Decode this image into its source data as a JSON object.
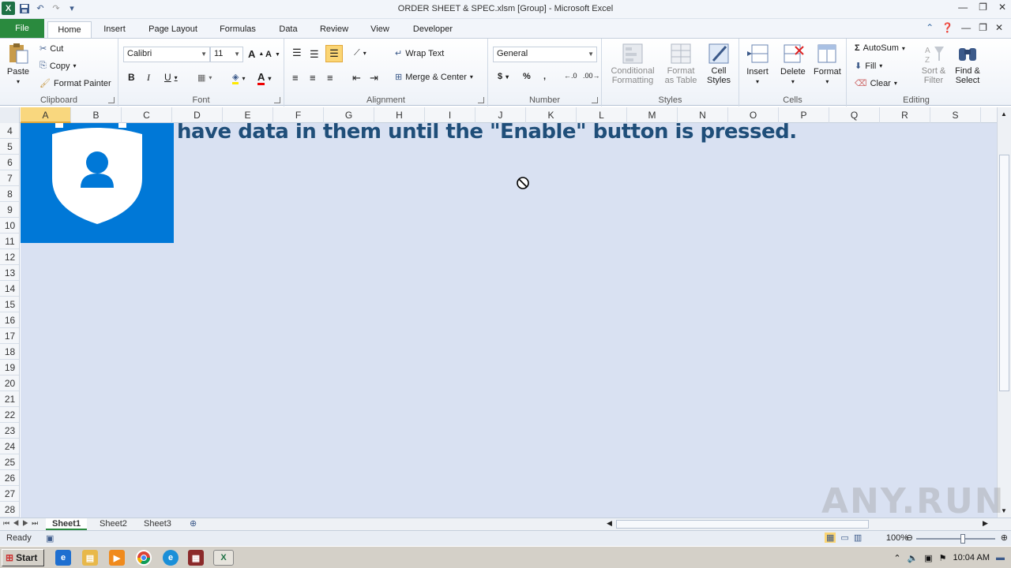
{
  "window": {
    "title": "ORDER SHEET & SPEC.xlsm  [Group]  -  Microsoft Excel"
  },
  "tabs": [
    "File",
    "Home",
    "Insert",
    "Page Layout",
    "Formulas",
    "Data",
    "Review",
    "View",
    "Developer"
  ],
  "ribbon": {
    "clipboard": {
      "paste": "Paste",
      "cut": "Cut",
      "copy": "Copy",
      "format_painter": "Format Painter",
      "label": "Clipboard"
    },
    "font": {
      "name": "Calibri",
      "size": "11",
      "label": "Font"
    },
    "alignment": {
      "wrap_text": "Wrap Text",
      "merge_center": "Merge & Center",
      "label": "Alignment"
    },
    "number": {
      "format": "General",
      "label": "Number"
    },
    "styles": {
      "conditional": "Conditional Formatting",
      "format_table": "Format as Table",
      "cell_styles": "Cell Styles",
      "label": "Styles"
    },
    "cells": {
      "insert": "Insert",
      "delete": "Delete",
      "format": "Format",
      "label": "Cells"
    },
    "editing": {
      "autosum": "AutoSum",
      "fill": "Fill",
      "clear": "Clear",
      "sort_filter": "Sort & Filter",
      "find_select": "Find & Select",
      "label": "Editing"
    }
  },
  "columns": [
    "A",
    "B",
    "C",
    "D",
    "E",
    "F",
    "G",
    "H",
    "I",
    "J",
    "K",
    "L",
    "M",
    "N",
    "O",
    "P",
    "Q",
    "R",
    "S"
  ],
  "rows": [
    "4",
    "5",
    "6",
    "7",
    "8",
    "9",
    "10",
    "11",
    "12",
    "13",
    "14",
    "15",
    "16",
    "17",
    "18",
    "19",
    "20",
    "21",
    "22",
    "23",
    "24",
    "25",
    "26",
    "27",
    "28"
  ],
  "sheet": {
    "banner_text": "have data in them until the \"Enable\" button is pressed."
  },
  "sheet_tabs": [
    "Sheet1",
    "Sheet2",
    "Sheet3"
  ],
  "status": {
    "ready": "Ready",
    "zoom": "100%"
  },
  "taskbar": {
    "start": "Start",
    "time": "10:04 AM"
  },
  "watermark": "ANY.RUN"
}
